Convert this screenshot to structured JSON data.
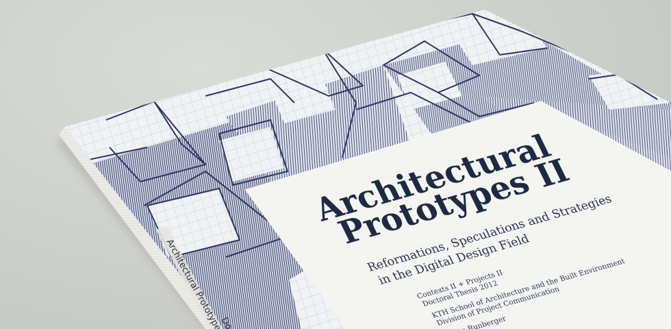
{
  "book": {
    "spine_title": "Architectural Prototypes II",
    "spine_extra": "Do",
    "title_line1": "Architectural",
    "title_line2": "Prototypes II",
    "subtitle_line1": "Reformations, Speculations and Strategies",
    "subtitle_line2": "in the Digital Design Field",
    "info_line1": "Contexts II + Projects II",
    "info_line2": "Doctoral Thesis 2012",
    "info_line3": "KTH School of Architecture and the Built Environment",
    "info_line4": "Division of Project Communication",
    "author": "Jonas Runberger"
  },
  "colors": {
    "ink": "#2c3560",
    "label_text": "#1e2a44",
    "label_bg": "#f4f4f1",
    "table": "#cfd1cc"
  }
}
